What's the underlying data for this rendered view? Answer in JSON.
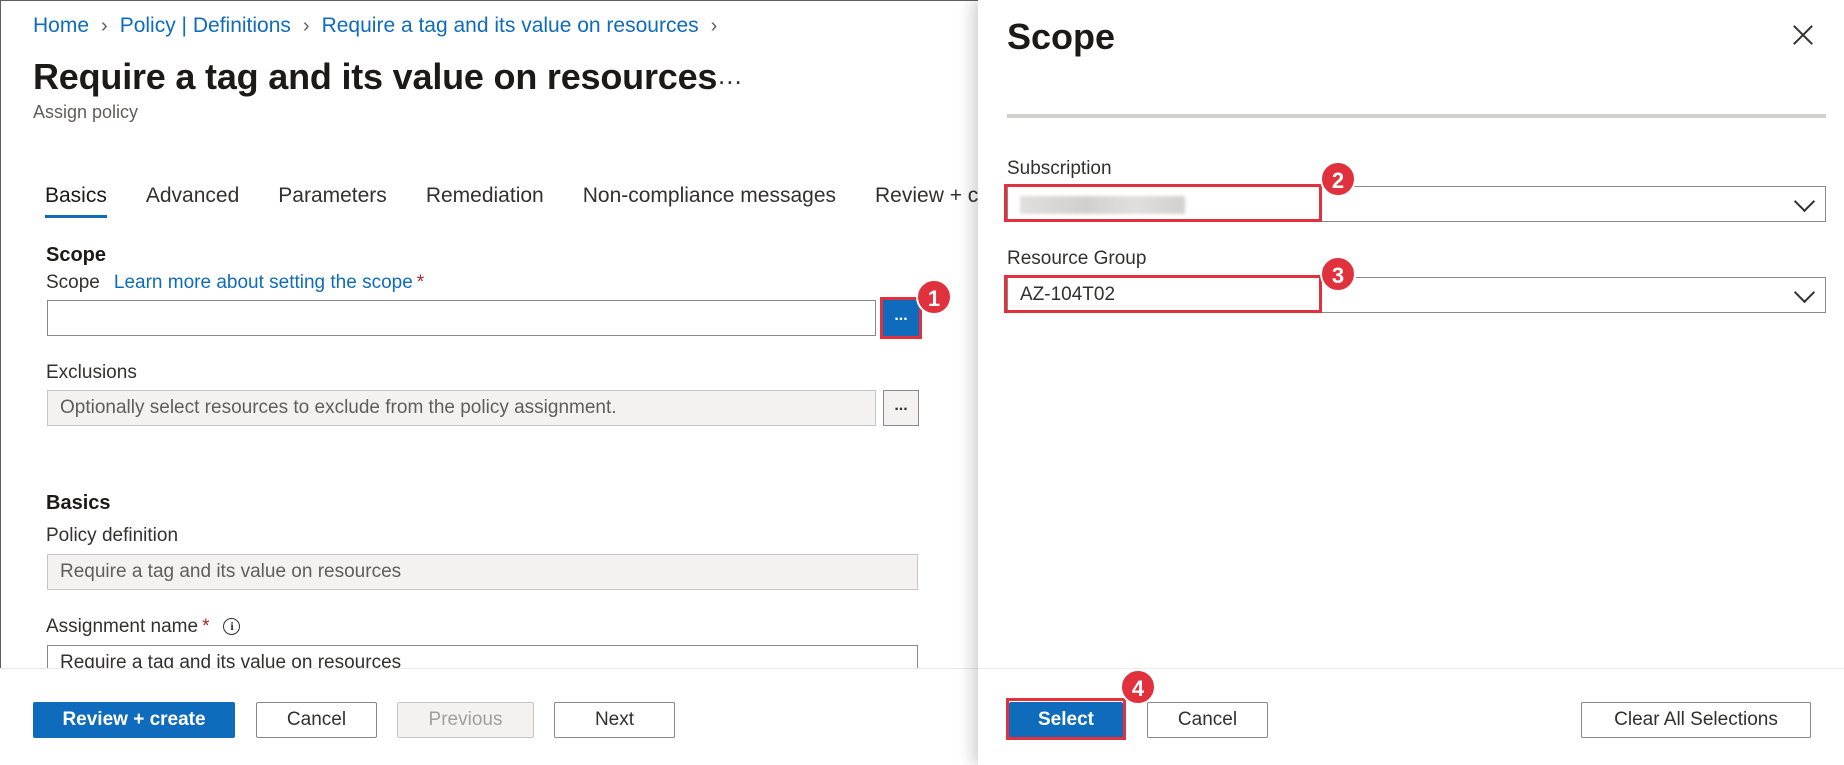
{
  "breadcrumb": {
    "items": [
      "Home",
      "Policy | Definitions",
      "Require a tag and its value on resources"
    ],
    "separator": ">"
  },
  "page": {
    "title": "Require a tag and its value on resources",
    "more": "...",
    "subtitle": "Assign policy"
  },
  "tabs": [
    "Basics",
    "Advanced",
    "Parameters",
    "Remediation",
    "Non-compliance messages",
    "Review + cre"
  ],
  "scope_section": {
    "heading": "Scope",
    "label": "Scope",
    "learn_more": "Learn more about setting the scope",
    "required_mark": "*",
    "value": "",
    "browse_label": "...",
    "exclusions_label": "Exclusions",
    "exclusions_placeholder": "Optionally select resources to exclude from the policy assignment.",
    "exclusions_browse": "..."
  },
  "basics_section": {
    "heading": "Basics",
    "policy_definition_label": "Policy definition",
    "policy_definition_value": "Require a tag and its value on resources",
    "assignment_name_label": "Assignment name",
    "required_mark": "*",
    "info_icon": "i",
    "assignment_name_value": "Require a tag and its value on resources"
  },
  "footer_left": {
    "review_create": "Review + create",
    "cancel": "Cancel",
    "previous": "Previous",
    "next": "Next"
  },
  "panel": {
    "title": "Scope",
    "subscription_label": "Subscription",
    "subscription_value": "",
    "resource_group_label": "Resource Group",
    "resource_group_value": "AZ-104T02",
    "select": "Select",
    "cancel": "Cancel",
    "clear_all": "Clear All Selections"
  },
  "annotations": [
    "1",
    "2",
    "3",
    "4"
  ],
  "colors": {
    "accent": "#0f6cbd",
    "highlight": "#e0313d"
  }
}
